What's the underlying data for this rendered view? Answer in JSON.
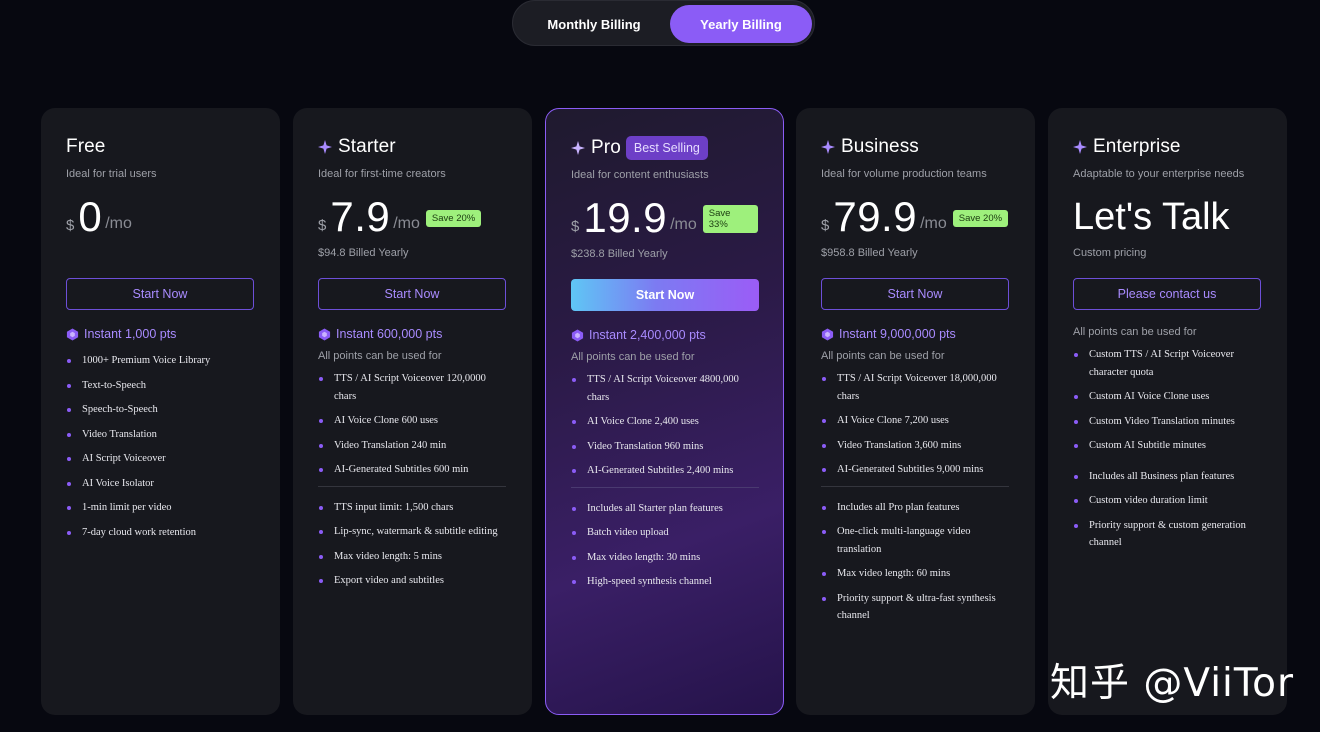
{
  "billing": {
    "monthly_label": "Monthly Billing",
    "yearly_label": "Yearly Billing",
    "selected": "yearly"
  },
  "plans": [
    {
      "name": "Free",
      "tagline": "Ideal for trial users",
      "currency": "$",
      "amount": "0",
      "per": "/mo",
      "save": "",
      "billed": "",
      "cta": "Start Now",
      "points": "Instant 1,000 pts",
      "note": "",
      "features_a": [
        "1000+ Premium Voice Library",
        "Text-to-Speech",
        "Speech-to-Speech",
        "Video Translation",
        "AI Script Voiceover",
        "AI Voice Isolator",
        "1-min limit per video",
        "7-day cloud work retention"
      ],
      "features_b": []
    },
    {
      "name": "Starter",
      "tagline": "Ideal for first-time creators",
      "currency": "$",
      "amount": "7.9",
      "per": "/mo",
      "save": "Save 20%",
      "billed": "$94.8 Billed Yearly",
      "cta": "Start Now",
      "points": "Instant 600,000 pts",
      "note": "All points can be used for",
      "features_a": [
        "TTS / AI Script Voiceover 120,0000 chars",
        "AI Voice Clone 600 uses",
        "Video Translation 240 min",
        "AI-Generated Subtitles 600 min"
      ],
      "features_b": [
        "TTS input limit: 1,500 chars",
        "Lip-sync, watermark & subtitle editing",
        "Max video length: 5 mins",
        "Export video and subtitles"
      ]
    },
    {
      "name": "Pro",
      "badge": "Best Selling",
      "tagline": "Ideal for content enthusiasts",
      "currency": "$",
      "amount": "19.9",
      "per": "/mo",
      "save": "Save 33%",
      "billed": "$238.8 Billed Yearly",
      "cta": "Start Now",
      "points": "Instant 2,400,000 pts",
      "note": "All points can be used for",
      "features_a": [
        "TTS / AI Script Voiceover 4800,000 chars",
        "AI Voice Clone 2,400 uses",
        "Video Translation 960 mins",
        "AI-Generated Subtitles 2,400 mins"
      ],
      "features_b": [
        "Includes all Starter plan features",
        "Batch video upload",
        "Max video length: 30 mins",
        "High-speed synthesis channel"
      ]
    },
    {
      "name": "Business",
      "tagline": "Ideal for volume production teams",
      "currency": "$",
      "amount": "79.9",
      "per": "/mo",
      "save": "Save 20%",
      "billed": "$958.8 Billed Yearly",
      "cta": "Start Now",
      "points": "Instant 9,000,000 pts",
      "note": "All points can be used for",
      "features_a": [
        "TTS / AI Script Voiceover 18,000,000 chars",
        "AI Voice Clone 7,200 uses",
        "Video Translation 3,600 mins",
        "AI-Generated Subtitles 9,000 mins"
      ],
      "features_b": [
        "Includes all Pro plan features",
        "One-click multi-language video translation",
        "Max video length: 60 mins",
        "Priority support & ultra-fast synthesis channel"
      ]
    },
    {
      "name": "Enterprise",
      "tagline": "Adaptable to your enterprise needs",
      "headline": "Let's Talk",
      "billed": "Custom pricing",
      "cta": "Please contact us",
      "note": "All points can be used for",
      "features_a": [
        "Custom TTS / AI Script Voiceover character quota",
        "Custom AI Voice Clone uses",
        "Custom Video Translation minutes",
        "Custom AI Subtitle minutes"
      ],
      "features_b": [
        "Includes all Business plan features",
        "Custom video duration limit",
        "Priority support & custom generation channel"
      ]
    }
  ],
  "watermark": "知乎 @ViiTor",
  "colors": {
    "accent": "#8b5cf6",
    "save_badge": "#9ef07c",
    "background": "#070810",
    "card": "#17181e"
  }
}
